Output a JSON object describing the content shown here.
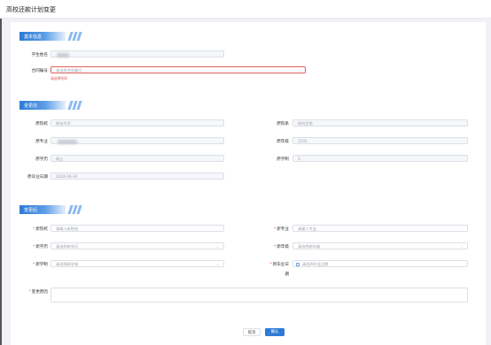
{
  "page": {
    "title": "高校还款计划变更"
  },
  "sections": {
    "basic": {
      "title": "基本信息"
    },
    "before": {
      "title": "变更前"
    },
    "after": {
      "title": "变更后"
    }
  },
  "basic": {
    "student_name_label": "学生姓名",
    "student_name_value": "",
    "contract_label": "合同编号",
    "contract_placeholder": "请选择合同编号",
    "contract_error": "请选择合同"
  },
  "before": {
    "school_label": "原院校",
    "school_value": "郑州大学",
    "dept_label": "原院系",
    "dept_value": "研究生院",
    "major_label": "原专业",
    "major_value": "",
    "grade_label": "原年级",
    "grade_value": "2101",
    "degree_label": "原学历",
    "degree_value": "硕士",
    "length_label": "原学制",
    "length_value": "3",
    "grad_label": "原毕业日期",
    "grad_value": "2024-06-30"
  },
  "after": {
    "school_label": "新院校",
    "school_placeholder": "请输入新院校",
    "major_label": "新专业",
    "major_placeholder": "请输入专业",
    "degree_label": "新学历",
    "degree_placeholder": "请选择新学历",
    "grade_label": "新年级",
    "grade_placeholder": "请选择新年级",
    "length_label": "新学制",
    "length_placeholder": "请选择新学制",
    "grad_label_1": "新毕业日",
    "grad_label_2": "期",
    "grad_placeholder": "请选择毕业日期",
    "reason_label": "变更原因"
  },
  "buttons": {
    "cancel": "取消",
    "confirm": "确认"
  }
}
